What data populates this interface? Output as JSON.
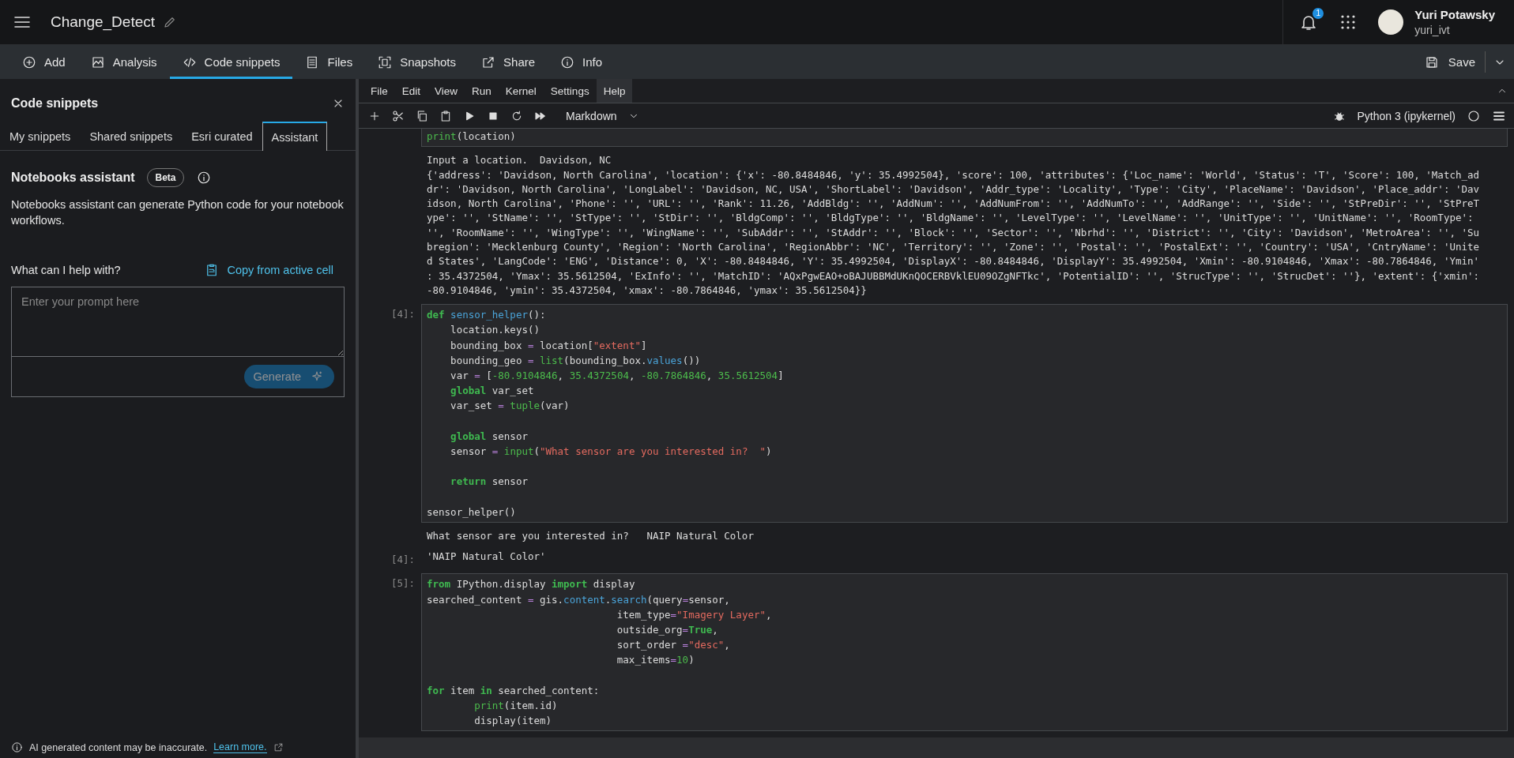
{
  "header": {
    "title": "Change_Detect",
    "notifications": "1",
    "user_name": "Yuri Potawsky",
    "username": "yuri_ivt"
  },
  "toolbar": {
    "items": [
      {
        "label": "Add",
        "selected": false
      },
      {
        "label": "Analysis",
        "selected": false
      },
      {
        "label": "Code snippets",
        "selected": true
      },
      {
        "label": "Files",
        "selected": false
      },
      {
        "label": "Snapshots",
        "selected": false
      },
      {
        "label": "Share",
        "selected": false
      },
      {
        "label": "Info",
        "selected": false
      }
    ],
    "save": "Save"
  },
  "snippets_panel": {
    "title": "Code snippets",
    "tabs": [
      {
        "label": "My snippets",
        "selected": false
      },
      {
        "label": "Shared snippets",
        "selected": false
      },
      {
        "label": "Esri curated",
        "selected": false
      },
      {
        "label": "Assistant",
        "selected": true
      }
    ],
    "assistant": {
      "title": "Notebooks assistant",
      "badge": "Beta",
      "description": "Notebooks assistant can generate Python code for your notebook workflows.",
      "prompt_label": "What can I help with?",
      "copy_link": "Copy from active cell",
      "placeholder": "Enter your prompt here",
      "generate": {
        "label": "Generate",
        "disabled": true
      }
    },
    "footer": {
      "text": "AI generated content may be inaccurate.",
      "link": "Learn more."
    }
  },
  "notebook": {
    "menu": [
      {
        "label": "File",
        "selected": false
      },
      {
        "label": "Edit",
        "selected": false
      },
      {
        "label": "View",
        "selected": false
      },
      {
        "label": "Run",
        "selected": false
      },
      {
        "label": "Kernel",
        "selected": false
      },
      {
        "label": "Settings",
        "selected": false
      },
      {
        "label": "Help",
        "selected": true
      }
    ],
    "cell_type": "Markdown",
    "kernel": "Python 3 (ipykernel)",
    "cells": [
      {
        "code": [
          {
            "text": "print",
            "kind": "builtin"
          },
          {
            "text": "(location)",
            "kind": "plain"
          }
        ],
        "outputs": [
          {
            "kind": "stream",
            "text": "Input a location.  Davidson, NC\n{'address': 'Davidson, North Carolina', 'location': {'x': -80.8484846, 'y': 35.4992504}, 'score': 100, 'attributes': {'Loc_name': 'World', 'Status': 'T', 'Score': 100, 'Match_ad\ndr': 'Davidson, North Carolina', 'LongLabel': 'Davidson, NC, USA', 'ShortLabel': 'Davidson', 'Addr_type': 'Locality', 'Type': 'City', 'PlaceName': 'Davidson', 'Place_addr': 'Dav\nidson, North Carolina', 'Phone': '', 'URL': '', 'Rank': 11.26, 'AddBldg': '', 'AddNum': '', 'AddNumFrom': '', 'AddNumTo': '', 'AddRange': '', 'Side': '', 'StPreDir': '', 'StPreT\nype': '', 'StName': '', 'StType': '', 'StDir': '', 'BldgComp': '', 'BldgType': '', 'BldgName': '', 'LevelType': '', 'LevelName': '', 'UnitType': '', 'UnitName': '', 'RoomType':\n'', 'RoomName': '', 'WingType': '', 'WingName': '', 'SubAddr': '', 'StAddr': '', 'Block': '', 'Sector': '', 'Nbrhd': '', 'District': '', 'City': 'Davidson', 'MetroArea': '', 'Su\nbregion': 'Mecklenburg County', 'Region': 'North Carolina', 'RegionAbbr': 'NC', 'Territory': '', 'Zone': '', 'Postal': '', 'PostalExt': '', 'Country': 'USA', 'CntryName': 'Unite\nd States', 'LangCode': 'ENG', 'Distance': 0, 'X': -80.8484846, 'Y': 35.4992504, 'DisplayX': -80.8484846, 'DisplayY': 35.4992504, 'Xmin': -80.9104846, 'Xmax': -80.7864846, 'Ymin'\n: 35.4372504, 'Ymax': 35.5612504, 'ExInfo': '', 'MatchID': 'AQxPgwEAO+oBAJUBBMdUKnQOCERBVklEU09OZgNFTkc', 'PotentialID': '', 'StrucType': '', 'StrucDet': ''}, 'extent': {'xmin':\n-80.9104846, 'ymin': 35.4372504, 'xmax': -80.7864846, 'ymax': 35.5612504}}"
          }
        ]
      },
      {
        "prompt": "[4]:",
        "code": [
          {
            "text": "def",
            "kind": "keyword"
          },
          {
            "text": " sensor_helper",
            "kind": "name"
          },
          {
            "text": "():\n    location.keys()\n    bounding_box ",
            "kind": "plain"
          },
          {
            "text": "=",
            "kind": "operator"
          },
          {
            "text": " location[",
            "kind": "plain"
          },
          {
            "text": "\"extent\"",
            "kind": "string"
          },
          {
            "text": "]\n    bounding_geo ",
            "kind": "plain"
          },
          {
            "text": "=",
            "kind": "operator"
          },
          {
            "text": " list",
            "kind": "builtin"
          },
          {
            "text": "(bounding_box.",
            "kind": "plain"
          },
          {
            "text": "values",
            "kind": "name"
          },
          {
            "text": "())\n    var ",
            "kind": "plain"
          },
          {
            "text": "=",
            "kind": "operator"
          },
          {
            "text": " [",
            "kind": "plain"
          },
          {
            "text": "-80.9104846",
            "kind": "number"
          },
          {
            "text": ", ",
            "kind": "plain"
          },
          {
            "text": "35.4372504",
            "kind": "number"
          },
          {
            "text": ", ",
            "kind": "plain"
          },
          {
            "text": "-80.7864846",
            "kind": "number"
          },
          {
            "text": ", ",
            "kind": "plain"
          },
          {
            "text": "35.5612504",
            "kind": "number"
          },
          {
            "text": "]\n    ",
            "kind": "plain"
          },
          {
            "text": "global",
            "kind": "keyword"
          },
          {
            "text": " var_set\n    var_set ",
            "kind": "plain"
          },
          {
            "text": "=",
            "kind": "operator"
          },
          {
            "text": " tuple",
            "kind": "builtin"
          },
          {
            "text": "(var)\n\n    ",
            "kind": "plain"
          },
          {
            "text": "global",
            "kind": "keyword"
          },
          {
            "text": " sensor\n    sensor ",
            "kind": "plain"
          },
          {
            "text": "=",
            "kind": "operator"
          },
          {
            "text": " input",
            "kind": "builtin"
          },
          {
            "text": "(",
            "kind": "plain"
          },
          {
            "text": "\"What sensor are you interested in?  \"",
            "kind": "string"
          },
          {
            "text": ")\n\n    ",
            "kind": "plain"
          },
          {
            "text": "return",
            "kind": "keyword"
          },
          {
            "text": " sensor\n\nsensor_helper()",
            "kind": "plain"
          }
        ],
        "outputs": [
          {
            "kind": "stream",
            "text": "What sensor are you interested in?   NAIP Natural Color"
          },
          {
            "kind": "result",
            "prompt": "[4]:",
            "text": "'NAIP Natural Color'"
          }
        ]
      },
      {
        "prompt": "[5]:",
        "code": [
          {
            "text": "from",
            "kind": "keyword"
          },
          {
            "text": " IPython.display ",
            "kind": "plain"
          },
          {
            "text": "import",
            "kind": "keyword"
          },
          {
            "text": " display\nsearched_content ",
            "kind": "plain"
          },
          {
            "text": "=",
            "kind": "operator"
          },
          {
            "text": " gis.",
            "kind": "plain"
          },
          {
            "text": "content",
            "kind": "name"
          },
          {
            "text": ".",
            "kind": "plain"
          },
          {
            "text": "search",
            "kind": "name"
          },
          {
            "text": "(query",
            "kind": "plain"
          },
          {
            "text": "=",
            "kind": "operator"
          },
          {
            "text": "sensor,\n                                item_type",
            "kind": "plain"
          },
          {
            "text": "=",
            "kind": "operator"
          },
          {
            "text": "\"Imagery Layer\"",
            "kind": "string"
          },
          {
            "text": ",\n                                outside_org",
            "kind": "plain"
          },
          {
            "text": "=",
            "kind": "operator"
          },
          {
            "text": "True",
            "kind": "keyword"
          },
          {
            "text": ",\n                                sort_order ",
            "kind": "plain"
          },
          {
            "text": "=",
            "kind": "operator"
          },
          {
            "text": "\"desc\"",
            "kind": "string"
          },
          {
            "text": ",\n                                max_items",
            "kind": "plain"
          },
          {
            "text": "=",
            "kind": "operator"
          },
          {
            "text": "10",
            "kind": "number"
          },
          {
            "text": ")\n\n",
            "kind": "plain"
          },
          {
            "text": "for",
            "kind": "keyword"
          },
          {
            "text": " item ",
            "kind": "plain"
          },
          {
            "text": "in",
            "kind": "keyword"
          },
          {
            "text": " searched_content:\n        ",
            "kind": "plain"
          },
          {
            "text": "print",
            "kind": "builtin"
          },
          {
            "text": "(item.id)\n        display(item)",
            "kind": "plain"
          }
        ]
      }
    ]
  }
}
